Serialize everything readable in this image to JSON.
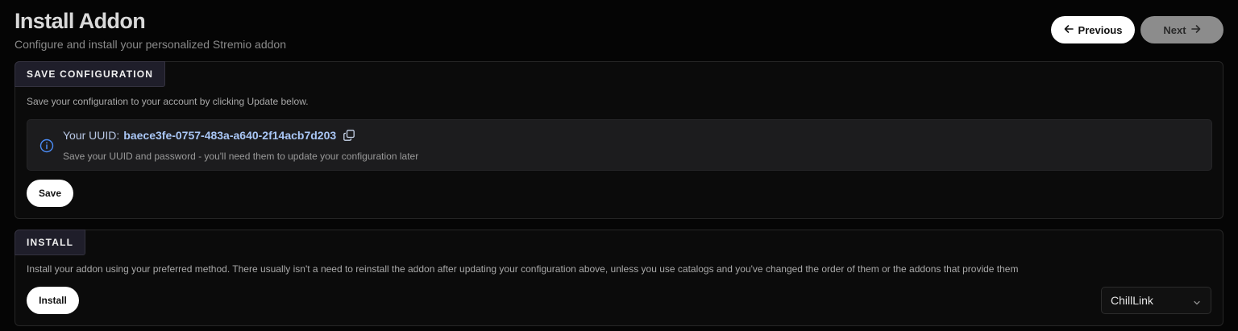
{
  "header": {
    "title": "Install Addon",
    "subtitle": "Configure and install your personalized Stremio addon"
  },
  "nav": {
    "previous_label": "Previous",
    "next_label": "Next",
    "previous_icon": "arrow-left-icon",
    "next_icon": "arrow-right-icon"
  },
  "save_section": {
    "tab_label": "SAVE CONFIGURATION",
    "description": "Save your configuration to your account by clicking Update below.",
    "info": {
      "icon": "info-icon",
      "uuid_label": "Your UUID:",
      "uuid_value": "baece3fe-0757-483a-a640-2f14acb7d203",
      "copy_icon": "copy-icon",
      "note": "Save your UUID and password - you'll need them to update your configuration later"
    },
    "save_label": "Save"
  },
  "install_section": {
    "tab_label": "INSTALL",
    "description": "Install your addon using your preferred method. There usually isn't a need to reinstall the addon after updating your configuration above, unless you use catalogs and you've changed the order of them or the addons that provide them",
    "install_label": "Install",
    "method_select": {
      "selected": "ChillLink",
      "icon": "chevron-down-icon"
    }
  },
  "colors": {
    "background": "#050505",
    "card_border": "#262626",
    "tab_background": "#1f1e2a",
    "info_background": "#1c1c1e",
    "info_accent": "#4b8df8",
    "uuid_text": "#a9c6f5",
    "button_primary": "#ffffff",
    "button_disabled": "#8c8c8c"
  }
}
